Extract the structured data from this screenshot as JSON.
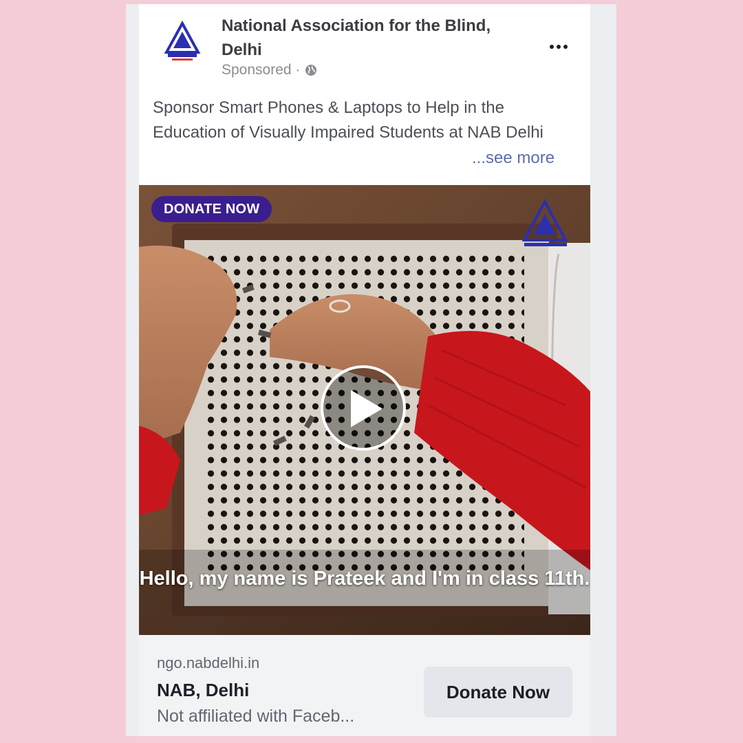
{
  "post": {
    "page_name": "National Association for the Blind, Delhi",
    "sponsored_label": "Sponsored ·",
    "more_icon": "more-options-icon",
    "caption": "Sponsor Smart Phones & Laptops to Help in the Education of Visually Impaired Students at NAB Delhi",
    "see_more": "...see more"
  },
  "media": {
    "badge": "DONATE NOW",
    "subtitle": "Hello, my name is Prateek and I'm in class 11th.",
    "play_icon": "play-icon"
  },
  "footer": {
    "domain": "ngo.nabdelhi.in",
    "advertiser": "NAB, Delhi",
    "disclaimer": "Not affiliated with Faceb...",
    "cta_label": "Donate Now"
  },
  "colors": {
    "background": "#f4cdd9",
    "brand": "#3a1e8f",
    "link": "#5b6dae",
    "sweater": "#c8161d"
  }
}
